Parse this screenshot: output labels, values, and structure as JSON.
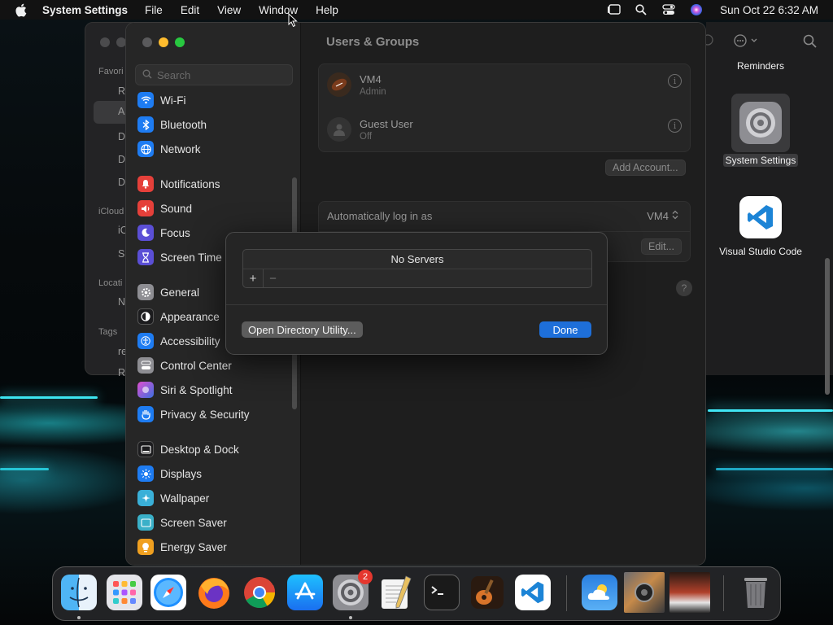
{
  "menubar": {
    "app_name": "System Settings",
    "menus": [
      "File",
      "Edit",
      "View",
      "Window",
      "Help"
    ],
    "clock": "Sun Oct 22  6:32 AM"
  },
  "finder_bg": {
    "labels": [
      "Favori",
      "iCloud",
      "Locati",
      "Tags"
    ],
    "stubs": [
      "R",
      "A",
      "D",
      "D",
      "D",
      "iC",
      "S",
      "N",
      "re",
      "R"
    ]
  },
  "desktop": {
    "reminders_label": "Reminders",
    "system_settings_label": "System Settings",
    "vscode_label": "Visual Studio Code"
  },
  "sidebar": {
    "search_placeholder": "Search",
    "items": [
      {
        "label": "Wi-Fi",
        "color": "#1e7cf2"
      },
      {
        "label": "Bluetooth",
        "color": "#1e7cf2"
      },
      {
        "label": "Network",
        "color": "#1e7cf2"
      },
      {
        "label": "Notifications",
        "color": "#e5403a"
      },
      {
        "label": "Sound",
        "color": "#e5403a"
      },
      {
        "label": "Focus",
        "color": "#5b4fd6"
      },
      {
        "label": "Screen Time",
        "color": "#5b4fd6"
      },
      {
        "label": "General",
        "color": "#8e8e93"
      },
      {
        "label": "Appearance",
        "color": "#1c1c1e"
      },
      {
        "label": "Accessibility",
        "color": "#1e7cf2"
      },
      {
        "label": "Control Center",
        "color": "#8e8e93"
      },
      {
        "label": "Siri & Spotlight",
        "color": "#b84fd6"
      },
      {
        "label": "Privacy & Security",
        "color": "#1e7cf2"
      },
      {
        "label": "Desktop & Dock",
        "color": "#1c1c1e"
      },
      {
        "label": "Displays",
        "color": "#1e7cf2"
      },
      {
        "label": "Wallpaper",
        "color": "#3ab0d8"
      },
      {
        "label": "Screen Saver",
        "color": "#3ab0c8"
      },
      {
        "label": "Energy Saver",
        "color": "#f0a020"
      }
    ]
  },
  "content": {
    "title": "Users & Groups",
    "users": [
      {
        "name": "VM4",
        "role": "Admin"
      },
      {
        "name": "Guest User",
        "role": "Off"
      }
    ],
    "add_account_label": "Add Account...",
    "auto_login_label": "Automatically log in as",
    "auto_login_value": "VM4",
    "edit_label": "Edit...",
    "help_label": "?"
  },
  "sheet": {
    "server_list_header": "No Servers",
    "add_label": "+",
    "remove_label": "−",
    "open_directory_label": "Open Directory Utility...",
    "done_label": "Done"
  },
  "dock": {
    "apps": [
      "finder-icon",
      "launchpad-icon",
      "safari-icon",
      "firefox-icon",
      "chrome-icon",
      "app-store-icon",
      "system-settings-icon",
      "textedit-icon",
      "terminal-icon",
      "garageband-icon",
      "vscode-icon",
      "weather-icon",
      "photo-thumbnail-1",
      "photo-thumbnail-2",
      "trash-icon"
    ],
    "settings_badge": "2"
  },
  "colors": {
    "accent": "#1e6fd9",
    "close": "#fe5f57",
    "minimize": "#febc2e",
    "zoom": "#28c840"
  }
}
